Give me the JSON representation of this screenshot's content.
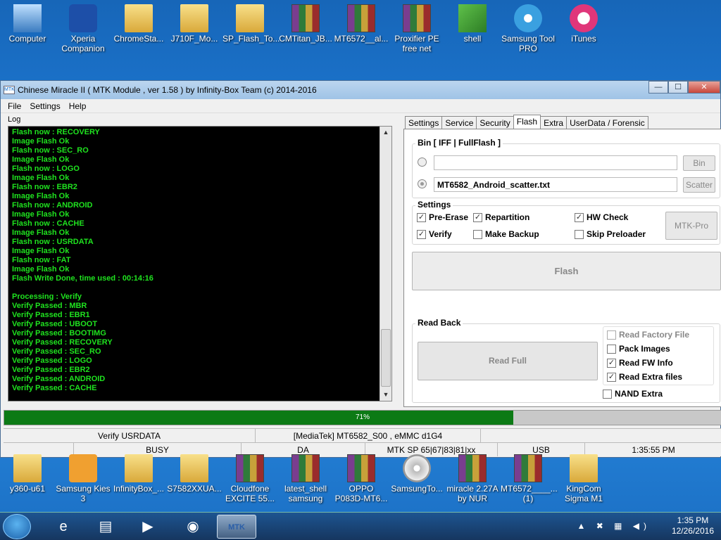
{
  "desktop_top": [
    {
      "label": "Computer",
      "icon": "computer-icon"
    },
    {
      "label": "Xperia Companion",
      "icon": "xperia-icon"
    },
    {
      "label": "ChromeSta...",
      "icon": "folder-icon"
    },
    {
      "label": "J710F_Mo...",
      "icon": "folder-icon"
    },
    {
      "label": "SP_Flash_To...",
      "icon": "folder-icon"
    },
    {
      "label": "CMTitan_JB...",
      "icon": "rar-icon"
    },
    {
      "label": "MT6572__al...",
      "icon": "rar-icon"
    },
    {
      "label": "Proxifier PE free net",
      "icon": "rar-icon"
    },
    {
      "label": "shell",
      "icon": "shell-icon"
    },
    {
      "label": "Samsung Tool PRO",
      "icon": "gear-icon"
    },
    {
      "label": "iTunes",
      "icon": "itunes-icon"
    }
  ],
  "desktop_bottom": [
    {
      "label": "y360-u61",
      "icon": "folder-icon"
    },
    {
      "label": "Samsung Kies 3",
      "icon": "kies-icon"
    },
    {
      "label": "InfinityBox_...",
      "icon": "folder-icon"
    },
    {
      "label": "S7582XXUA...",
      "icon": "folder-icon"
    },
    {
      "label": "Cloudfone EXCITE 55...",
      "icon": "rar-icon"
    },
    {
      "label": "latest_shell samsung",
      "icon": "rar-icon"
    },
    {
      "label": "OPPO P083D-MT6...",
      "icon": "rar-icon"
    },
    {
      "label": "SamsungTo...",
      "icon": "disc-icon"
    },
    {
      "label": "miracle 2.27A by NUR",
      "icon": "rar-icon"
    },
    {
      "label": "MT6572____... (1)",
      "icon": "rar-icon"
    },
    {
      "label": "KingCom Sigma M1",
      "icon": "folder-icon"
    }
  ],
  "window": {
    "title": "Chinese Miracle II ( MTK Module , ver 1.58 ) by Infinity-Box Team (c) 2014-2016",
    "appicon": "MTK",
    "buttons": {
      "min": "—",
      "max": "☐",
      "close": "✕"
    }
  },
  "menu": [
    "File",
    "Settings",
    "Help"
  ],
  "log": {
    "caption": "Log",
    "lines": [
      "Flash now : RECOVERY",
      "Image Flash Ok",
      "Flash now : SEC_RO",
      "Image Flash Ok",
      "Flash now : LOGO",
      "Image Flash Ok",
      "Flash now : EBR2",
      "Image Flash Ok",
      "Flash now : ANDROID",
      "Image Flash Ok",
      "Flash now : CACHE",
      "Image Flash Ok",
      "Flash now : USRDATA",
      "Image Flash Ok",
      "Flash now : FAT",
      "Image Flash Ok",
      "Flash Write Done, time used : 00:14:16",
      "",
      "Processing : Verify",
      "Verify Passed : MBR",
      "Verify Passed : EBR1",
      "Verify Passed : UBOOT",
      "Verify Passed : BOOTIMG",
      "Verify Passed : RECOVERY",
      "Verify Passed : SEC_RO",
      "Verify Passed : LOGO",
      "Verify Passed : EBR2",
      "Verify Passed : ANDROID",
      "Verify Passed : CACHE"
    ]
  },
  "tabs": [
    "Settings",
    "Service",
    "Security",
    "Flash",
    "Extra",
    "UserData / Forensic"
  ],
  "active_tab": "Flash",
  "bin": {
    "title": "Bin  [ IFF | FullFlash ]",
    "field1": "",
    "field2": "MT6582_Android_scatter.txt",
    "bin_btn": "Bin",
    "scatter_btn": "Scatter"
  },
  "settings": {
    "title": "Settings",
    "pre_erase": "Pre-Erase",
    "repartition": "Repartition",
    "hw_check": "HW Check",
    "verify": "Verify",
    "make_backup": "Make Backup",
    "skip_preloader": "Skip Preloader",
    "mtk_pro": "MTK-Pro"
  },
  "flash_btn": "Flash",
  "readback": {
    "title": "Read Back",
    "read_full": "Read Full",
    "read_factory": "Read Factory File",
    "pack_images": "Pack Images",
    "read_fw_info": "Read FW Info",
    "read_extra": "Read Extra files",
    "nand_extra": "NAND Extra"
  },
  "progress": {
    "text": "71%",
    "value": 0.71
  },
  "status1": [
    "Verify USRDATA",
    "[MediaTek] MT6582_S00 , eMMC d1G4",
    ""
  ],
  "status2": [
    "",
    "BUSY",
    "DA",
    "MTK SP 65|67|83|81|xx",
    "USB",
    "1:35:55 PM"
  ],
  "taskbar": {
    "items": [
      {
        "icon": "ie-icon",
        "glyph": "e"
      },
      {
        "icon": "explorer-icon",
        "glyph": "▤"
      },
      {
        "icon": "media-icon",
        "glyph": "▶"
      },
      {
        "icon": "chrome-icon",
        "glyph": "◉"
      },
      {
        "icon": "mtk-icon",
        "glyph": "MTK"
      }
    ],
    "time": "1:35 PM",
    "date": "12/26/2016",
    "tray": "▲ ✖ ▦ ◀)"
  },
  "colors": {
    "log_text": "#1fe31f",
    "progress": "#0c7a15"
  }
}
